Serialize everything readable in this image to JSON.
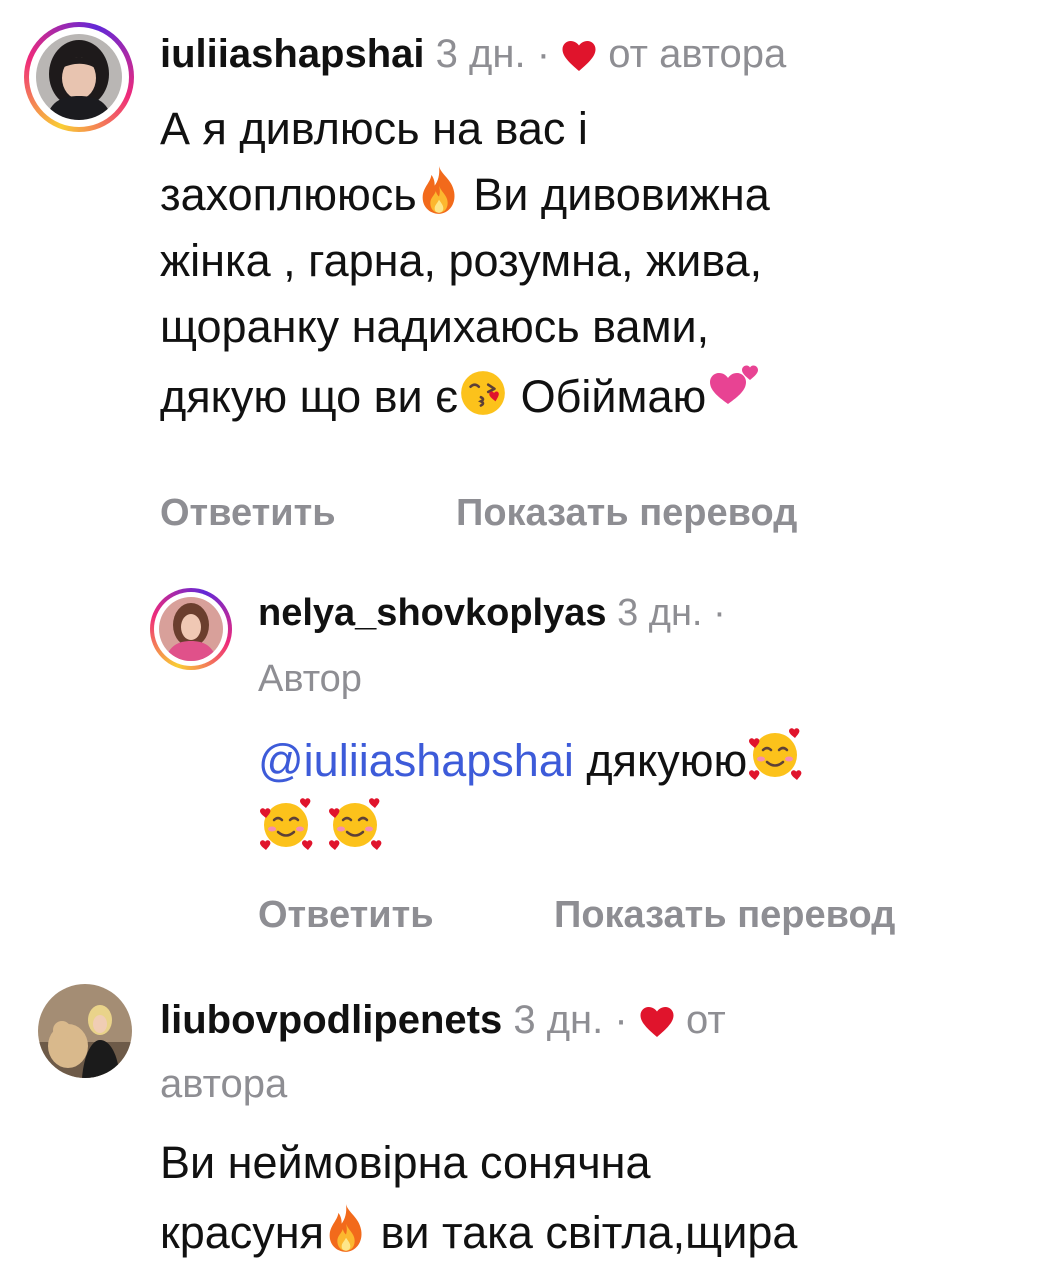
{
  "comments": [
    {
      "username": "iuliiashapshai",
      "time": "3 дн.",
      "separator": "·",
      "liked_label": "от автора",
      "text_lines": [
        "А я дивлюсь на вас і",
        "захоплююсь",
        "Ви дивовижна",
        "жінка , гарна, розумна, жива,",
        "щоранку надихаюсь вами,",
        "дякую що ви є",
        "Обіймаю"
      ],
      "reply_label": "Ответить",
      "translate_label": "Показать перевод"
    },
    {
      "username": "nelya_shovkoplyas",
      "time": "3 дн.",
      "separator": "·",
      "author_label": "Автор",
      "mention": "@iuliiashapshai",
      "text": "дякуюю",
      "reply_label": "Ответить",
      "translate_label": "Показать перевод"
    },
    {
      "username": "liubovpodlipenets",
      "time": "3 дн.",
      "separator": "·",
      "liked_label_part1": "от",
      "liked_label_part2": "автора",
      "text_lines": [
        "Ви неймовірна сонячна",
        "красуня",
        "ви така світла,щира"
      ]
    }
  ],
  "icons": {
    "heart": "heart-icon",
    "fire": "fire-emoji",
    "kiss": "face-blowing-kiss-emoji",
    "two_hearts": "two-hearts-emoji",
    "smiling_hearts": "smiling-face-with-hearts-emoji"
  },
  "colors": {
    "heart": "#e0142c",
    "mention": "#3d5bd9",
    "secondary_text": "#8e8e93",
    "primary_text": "#111111"
  }
}
